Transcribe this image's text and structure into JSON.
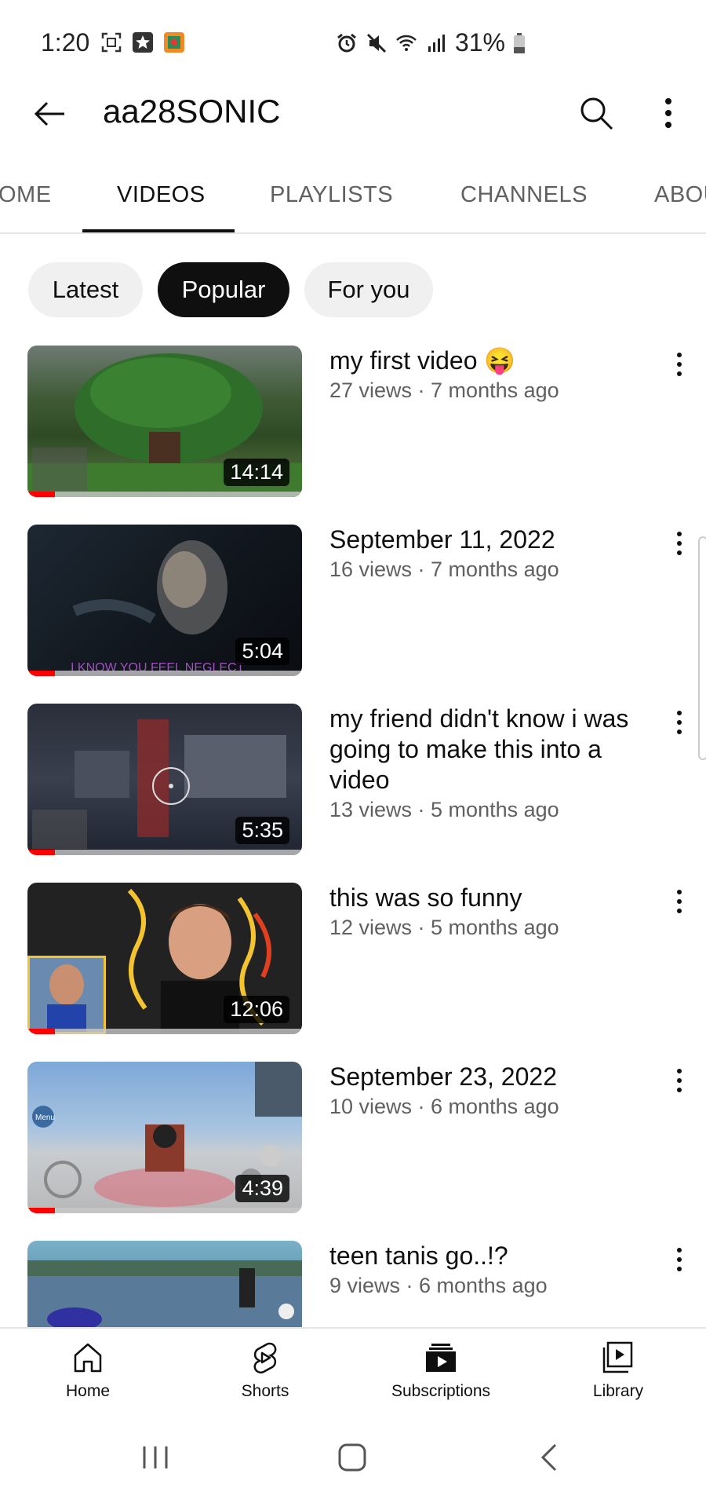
{
  "status_bar": {
    "time": "1:20",
    "battery": "31%"
  },
  "header": {
    "title": "aa28SONIC"
  },
  "tabs": [
    {
      "label": "OME"
    },
    {
      "label": "VIDEOS"
    },
    {
      "label": "PLAYLISTS"
    },
    {
      "label": "CHANNELS"
    },
    {
      "label": "ABOU"
    }
  ],
  "chips": [
    {
      "label": "Latest"
    },
    {
      "label": "Popular"
    },
    {
      "label": "For you"
    }
  ],
  "videos": [
    {
      "title": "my first video 😝",
      "meta": "27 views · 7 months ago",
      "duration": "14:14",
      "progress": 0.1
    },
    {
      "title": "September 11, 2022",
      "meta": "16 views · 7 months ago",
      "duration": "5:04",
      "progress": 0.1
    },
    {
      "title": "my friend didn't know i was going to make this into a video",
      "meta": "13 views · 5 months ago",
      "duration": "5:35",
      "progress": 0.1
    },
    {
      "title": "this was so funny",
      "meta": "12 views · 5 months ago",
      "duration": "12:06",
      "progress": 0.1
    },
    {
      "title": "September 23, 2022",
      "meta": "10 views · 6 months ago",
      "duration": "4:39",
      "progress": 0.1
    },
    {
      "title": "teen tanis go..!?",
      "meta": "9 views · 6 months ago",
      "duration": "",
      "progress": 0
    }
  ],
  "thumbnail_text": {
    "video2_caption": "I KNOW YOU FEEL NEGLECT",
    "video3_label": "…",
    "video5_menu": "Menu"
  },
  "bottom_nav": [
    {
      "label": "Home",
      "icon": "home-icon"
    },
    {
      "label": "Shorts",
      "icon": "shorts-icon"
    },
    {
      "label": "Subscriptions",
      "icon": "subscriptions-icon"
    },
    {
      "label": "Library",
      "icon": "library-icon"
    }
  ],
  "colors": {
    "accent_red": "#ff0000",
    "chip_active": "#0f0f0f",
    "chip_bg": "#f0f0f0",
    "meta_text": "#606060"
  }
}
